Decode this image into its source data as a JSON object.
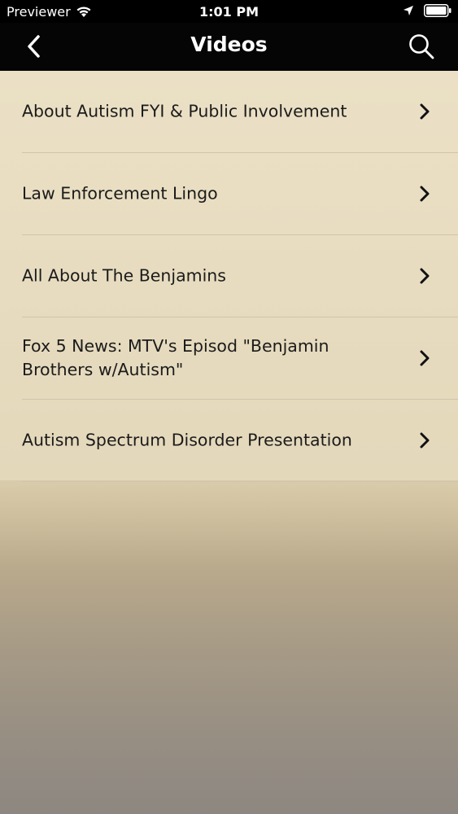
{
  "status_bar": {
    "carrier": "Previewer",
    "time": "1:01 PM"
  },
  "nav": {
    "title": "Videos",
    "back_icon": "chevron-left-icon",
    "search_icon": "search-icon"
  },
  "list": {
    "items": [
      {
        "label": "About Autism FYI & Public Involvement"
      },
      {
        "label": "Law Enforcement Lingo"
      },
      {
        "label": "All About The Benjamins"
      },
      {
        "label": "Fox 5 News: MTV's Episod \"Benjamin Brothers w/Autism\""
      },
      {
        "label": "Autism Spectrum Disorder Presentation"
      }
    ]
  },
  "colors": {
    "nav_background": "#050505",
    "list_background": "#ebe0c5",
    "text": "#1b1b1b"
  }
}
